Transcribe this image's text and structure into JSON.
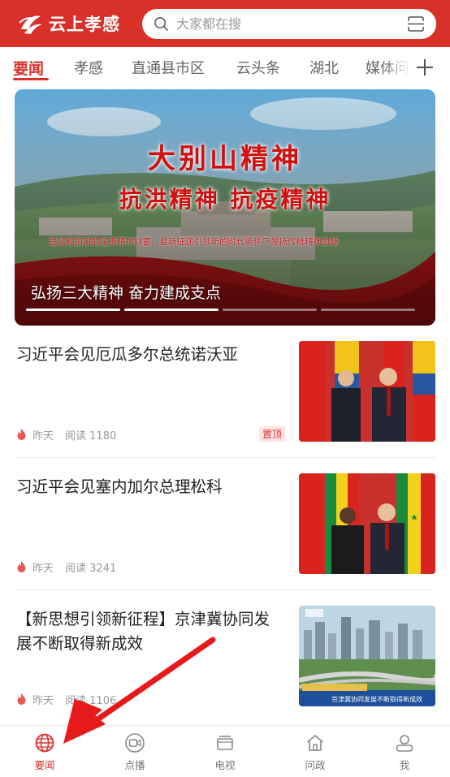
{
  "colors": {
    "brand": "#d8312a",
    "text": "#222222",
    "muted": "#999999",
    "annotation": "#e8191b"
  },
  "header": {
    "logo_text": "云上孝感",
    "search_placeholder": "大家都在搜"
  },
  "tabs": [
    {
      "label": "要闻",
      "active": true
    },
    {
      "label": "孝感"
    },
    {
      "label": "直通县市区"
    },
    {
      "label": "云头条"
    },
    {
      "label": "湖北"
    },
    {
      "label": "媒体问"
    }
  ],
  "banner": {
    "headline": "大别山精神",
    "subline": "抗洪精神  抗疫精神",
    "slogan": "是党和国家的宝贵精神财富，最新征途引领新的时代条件下发扬传统精神血脉",
    "caption": "弘扬三大精神 奋力建成支点",
    "slides": 4,
    "active_slide": 1
  },
  "news": [
    {
      "title": "习近平会见厄瓜多尔总统诺沃亚",
      "time": "昨天",
      "reads": "阅读 1180",
      "badge": "置顶"
    },
    {
      "title": "习近平会见塞内加尔总理松科",
      "time": "昨天",
      "reads": "阅读 3241",
      "badge": ""
    },
    {
      "title": "【新思想引领新征程】京津冀协同发展不断取得新成效",
      "time": "昨天",
      "reads": "阅读 1106",
      "badge": "",
      "thumb_caption": "京津冀协同发展不断取得新成效"
    }
  ],
  "bottom_nav": [
    {
      "label": "要闻",
      "icon": "globe-icon",
      "active": true
    },
    {
      "label": "点播",
      "icon": "video-icon"
    },
    {
      "label": "电视",
      "icon": "tv-icon"
    },
    {
      "label": "问政",
      "icon": "home-icon"
    },
    {
      "label": "我",
      "icon": "user-icon"
    }
  ]
}
